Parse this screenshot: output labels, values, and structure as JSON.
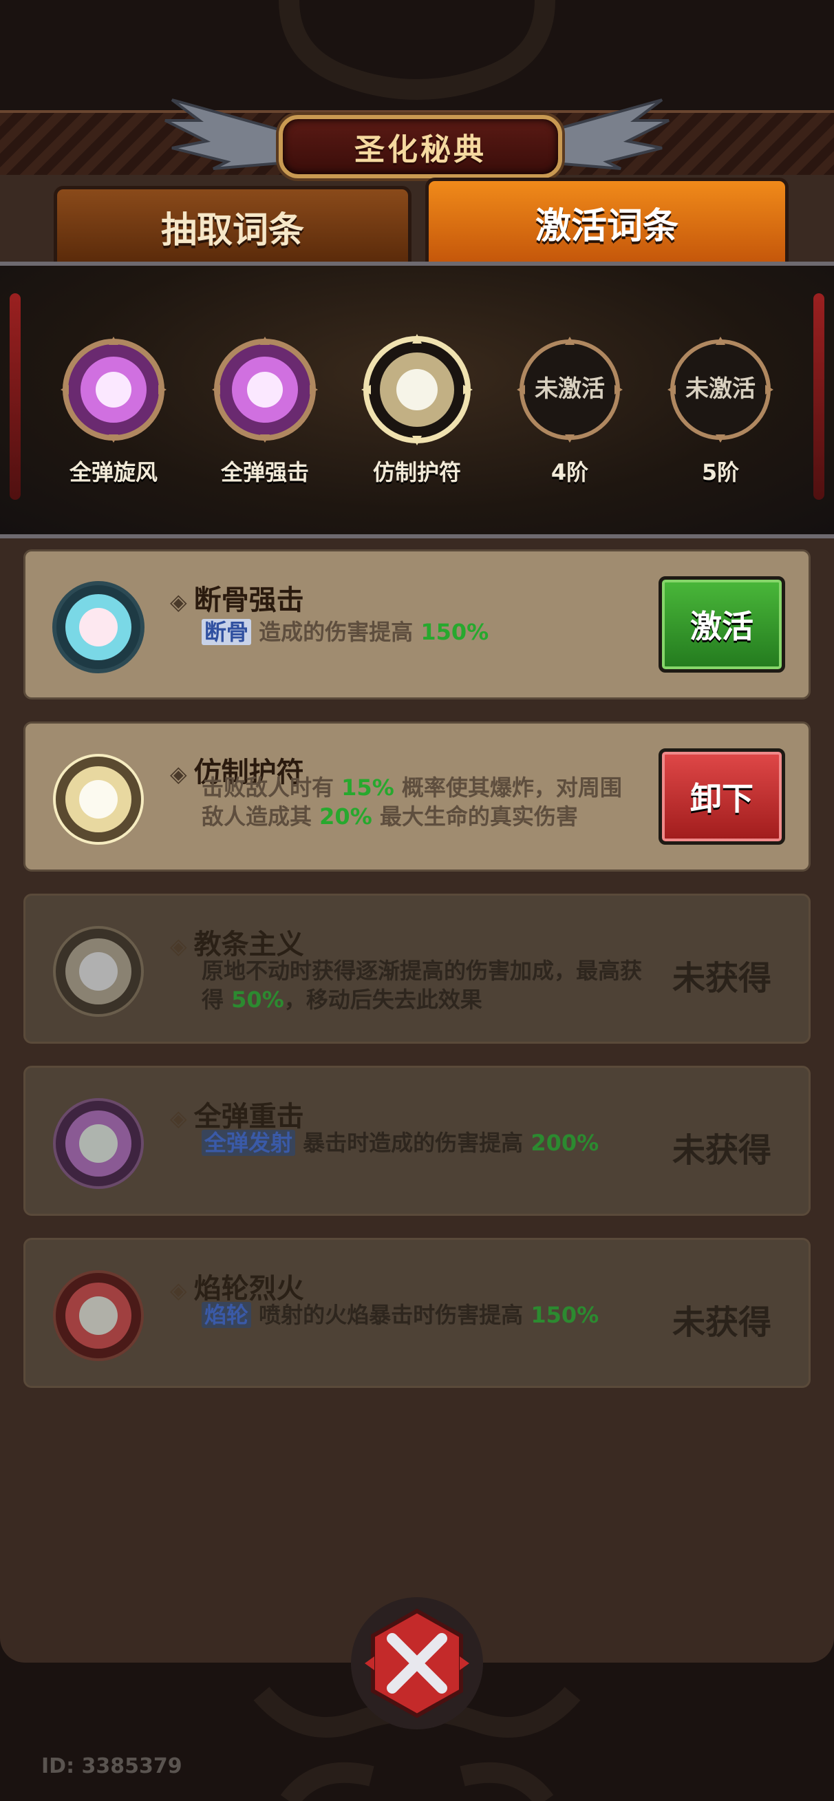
{
  "header": {
    "title": "圣化秘典"
  },
  "tabs": [
    {
      "label": "抽取词条",
      "active": false
    },
    {
      "label": "激活词条",
      "active": true
    }
  ],
  "slots": [
    {
      "label": "全弹旋风",
      "state": "active",
      "color": "#d070e0",
      "text": ""
    },
    {
      "label": "全弹强击",
      "state": "active",
      "color": "#d070e0",
      "text": ""
    },
    {
      "label": "仿制护符",
      "state": "active",
      "color": "#f0e0a0",
      "text": ""
    },
    {
      "label": "4阶",
      "state": "locked",
      "color": "#1a1410",
      "text": "未激活"
    },
    {
      "label": "5阶",
      "state": "locked",
      "color": "#1a1410",
      "text": "未激活"
    }
  ],
  "cards": [
    {
      "title": "断骨强击",
      "desc": {
        "kw": "断骨",
        "pre": " 造成的伤害提高 ",
        "num": "150%",
        "post": ""
      },
      "button": "激活",
      "state": "available",
      "orb_color": "#8fe6f0"
    },
    {
      "title": "仿制护符",
      "desc": {
        "kw": "",
        "pre": "击败敌人时有 ",
        "num": "15%",
        "post": " 概率使其爆炸，对周围敌人造成其 ",
        "num2": "20%",
        "post2": " 最大生命的真实伤害"
      },
      "button": "卸下",
      "state": "equipped",
      "orb_color": "#f3e2a8"
    },
    {
      "title": "教条主义",
      "desc": {
        "kw": "",
        "pre": "原地不动时获得逐渐提高的伤害加成，最高获得 ",
        "num": "50%",
        "post": "，移动后失去此效果"
      },
      "button": "未获得",
      "state": "locked",
      "orb_color": "#b6b2a2"
    },
    {
      "title": "全弹重击",
      "desc": {
        "kw": "全弹发射",
        "pre": " 暴击时造成的伤害提高 ",
        "num": "200%",
        "post": ""
      },
      "button": "未获得",
      "state": "locked",
      "orb_color": "#c27ed0"
    },
    {
      "title": "焰轮烈火",
      "desc": {
        "kw": "焰轮",
        "pre": " 喷射的火焰暴击时伤害提高 ",
        "num": "150%",
        "post": ""
      },
      "button": "未获得",
      "state": "locked",
      "orb_color": "#e05050"
    }
  ],
  "footer": {
    "id_text": "ID: 3385379"
  },
  "icons": {
    "close": "close-x-icon",
    "diamond": "◈"
  }
}
